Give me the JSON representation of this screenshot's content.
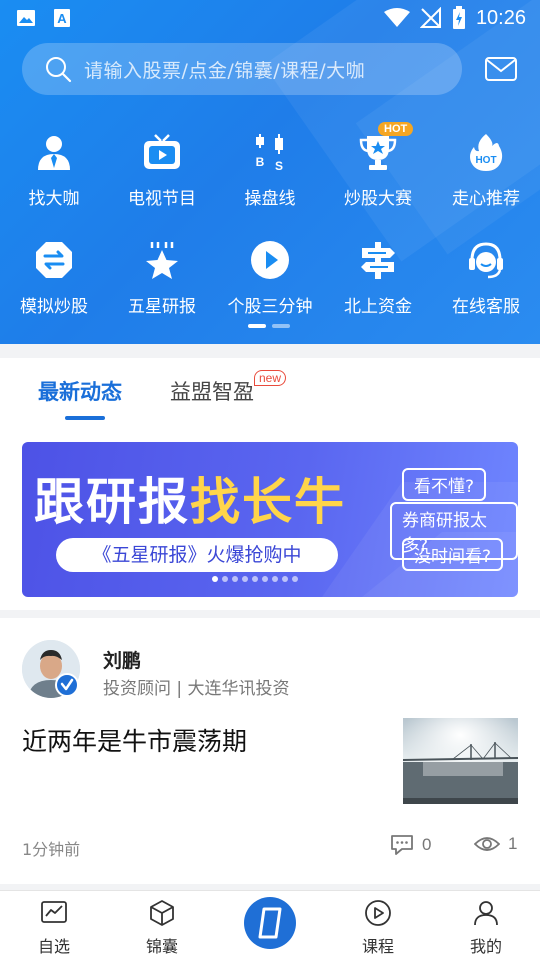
{
  "status_bar": {
    "time": "10:26"
  },
  "search": {
    "placeholder": "请输入股票/点金/锦囊/课程/大咖"
  },
  "grid": {
    "row1": [
      {
        "label": "找大咖",
        "icon": "advisor-icon"
      },
      {
        "label": "电视节目",
        "icon": "tv-icon"
      },
      {
        "label": "操盘线",
        "icon": "candlestick-icon"
      },
      {
        "label": "炒股大赛",
        "icon": "trophy-icon",
        "badge": "HOT"
      },
      {
        "label": "走心推荐",
        "icon": "hot-flame-icon",
        "icon_text": "HOT"
      }
    ],
    "row2": [
      {
        "label": "模拟炒股",
        "icon": "exchange-icon"
      },
      {
        "label": "五星研报",
        "icon": "star-report-icon"
      },
      {
        "label": "个股三分钟",
        "icon": "play-icon"
      },
      {
        "label": "北上资金",
        "icon": "signpost-icon"
      },
      {
        "label": "在线客服",
        "icon": "headset-icon"
      }
    ]
  },
  "tabs": {
    "active": "最新动态",
    "inactive": "益盟智盈",
    "new_badge": "new"
  },
  "banner": {
    "headline_white": "跟研报",
    "headline_yellow": "找长牛",
    "pill": "《五星研报》火爆抢购中",
    "questions": [
      "看不懂?",
      "券商研报太多?",
      "没时间看?"
    ],
    "dots_total": 9,
    "dots_active": 1
  },
  "post": {
    "author_name": "刘鹏",
    "author_title": "投资顾问 | 大连华讯投资",
    "title": "近两年是牛市震荡期",
    "time": "1分钟前",
    "comments": "0",
    "views": "1"
  },
  "tabbar": {
    "items": [
      {
        "label": "自选",
        "icon": "chart-icon"
      },
      {
        "label": "锦囊",
        "icon": "box-icon"
      },
      {
        "label": "课程",
        "icon": "play-circle-icon"
      },
      {
        "label": "我的",
        "icon": "user-icon"
      }
    ]
  },
  "colors": {
    "primary": "#1f6fd6",
    "hero": "#1a8df2",
    "hot": "#f5a623",
    "new": "#e94b3c"
  }
}
